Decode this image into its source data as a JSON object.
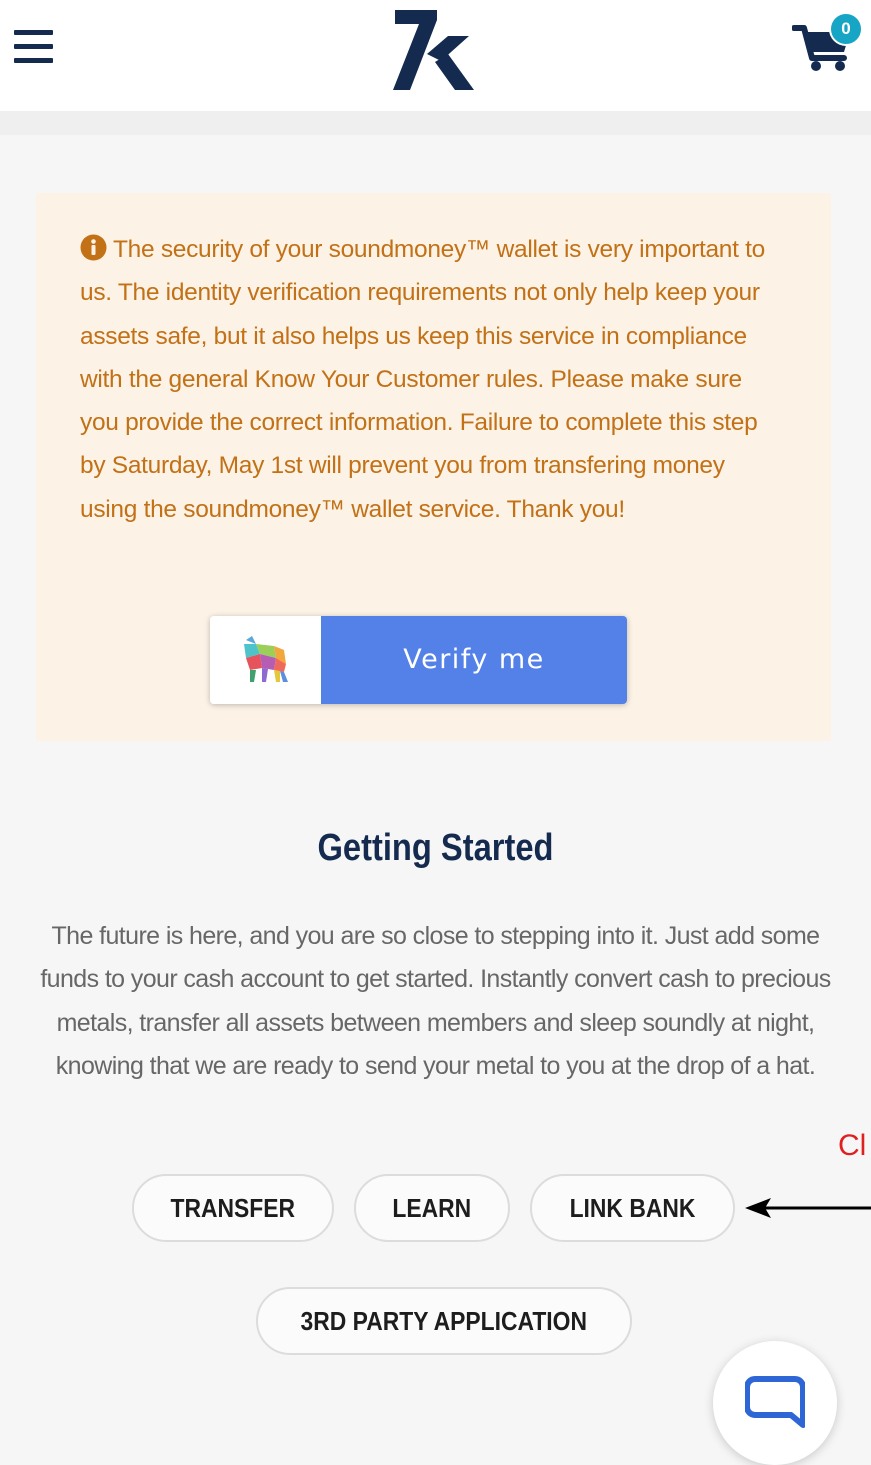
{
  "header": {
    "menu_icon": "hamburger-menu-icon",
    "logo_icon": "7k-logo",
    "cart_icon": "shopping-cart-icon",
    "cart_count": "0"
  },
  "notice": {
    "icon": "info-icon",
    "text": "The security of your soundmoney™ wallet is very important to us. The identity verification requirements not only help keep your assets safe, but it also helps us keep this service in compliance with the general Know Your Customer rules. Please make sure you provide the correct information. Failure to complete this step by Saturday, May 1st will prevent you from transfering money using the soundmoney™ wallet service. Thank you!",
    "verify_button_label": "Verify me",
    "verify_button_icon": "colorful-wolf-logo"
  },
  "getting_started": {
    "title": "Getting Started",
    "body": "The future is here, and you are so close to stepping into it. Just add some funds to your cash account to get started. Instantly convert cash to precious metals, transfer all assets between members and sleep soundly at night, knowing that we are ready to send your metal to you at the drop of a hat.",
    "buttons": {
      "transfer": "TRANSFER",
      "learn": "LEARN",
      "link_bank": "LINK BANK",
      "third_party": "3RD PARTY APPLICATION"
    }
  },
  "annotation": {
    "text": "Cl",
    "arrow_icon": "left-arrow-icon"
  },
  "chat": {
    "icon": "chat-bubble-icon"
  },
  "colors": {
    "brand_navy": "#142a4f",
    "notice_text": "#c27116",
    "notice_bg": "#fcf2e6",
    "verify_blue": "#5381e8",
    "badge_teal": "#17a5c5",
    "annotation_red": "#e02020"
  }
}
